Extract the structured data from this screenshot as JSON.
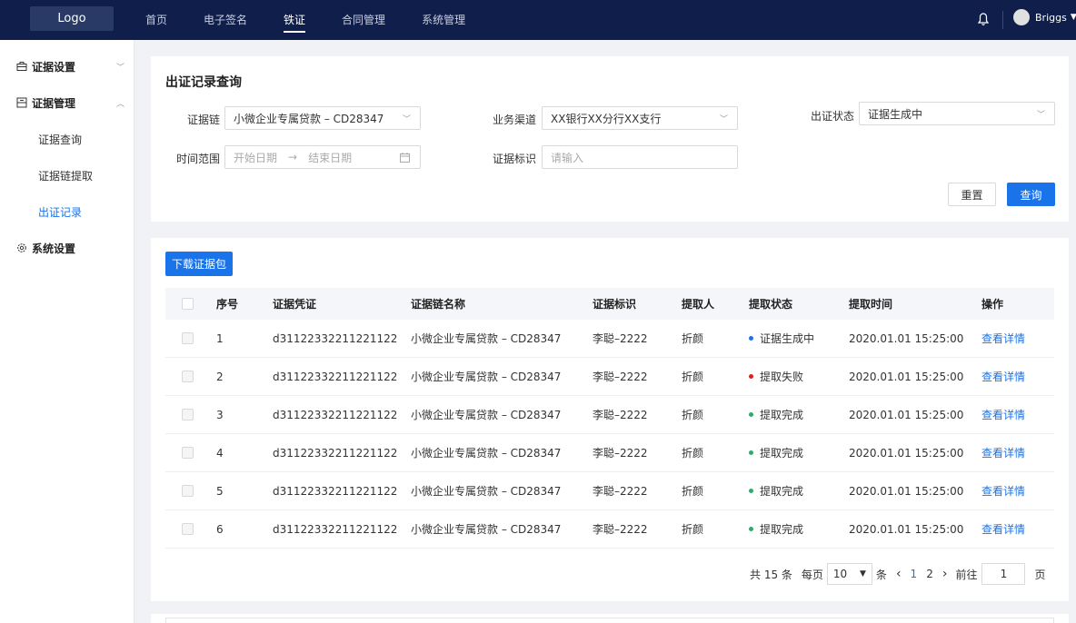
{
  "header": {
    "logo": "Logo",
    "nav": [
      "首页",
      "电子签名",
      "铁证",
      "合同管理",
      "系统管理"
    ],
    "active_nav": "铁证",
    "user_name": "Briggs"
  },
  "sidebar": {
    "groups": [
      {
        "label": "证据设置",
        "expanded": false
      },
      {
        "label": "证据管理",
        "expanded": true,
        "items": [
          "证据查询",
          "证据链提取",
          "出证记录"
        ]
      },
      {
        "label": "系统设置"
      }
    ],
    "active_item": "出证记录"
  },
  "search": {
    "title": "出证记录查询",
    "chain_label": "证据链",
    "chain_value": "小微企业专属贷款 – CD28347",
    "channel_label": "业务渠道",
    "channel_value": "XX银行XX分行XX支行",
    "status_label": "出证状态",
    "status_value": "证据生成中",
    "time_label": "时间范围",
    "start_placeholder": "开始日期",
    "arrow": "→",
    "end_placeholder": "结束日期",
    "tag_label": "证据标识",
    "tag_placeholder": "请输入",
    "reset": "重置",
    "query": "查询"
  },
  "table": {
    "download": "下载证据包",
    "headers": [
      "序号",
      "证据凭证",
      "证据链名称",
      "证据标识",
      "提取人",
      "提取状态",
      "提取时间",
      "操作"
    ],
    "rows": [
      {
        "no": "1",
        "voucher": "d31122332211221122",
        "chain": "小微企业专属贷款 – CD28347",
        "tag": "李聪–2222",
        "person": "折颜",
        "status": "证据生成中",
        "status_color": "#1a73e8",
        "time": "2020.01.01 15:25:00",
        "action": "查看详情"
      },
      {
        "no": "2",
        "voucher": "d31122332211221122",
        "chain": "小微企业专属贷款 – CD28347",
        "tag": "李聪–2222",
        "person": "折颜",
        "status": "提取失败",
        "status_color": "#e02020",
        "time": "2020.01.01 15:25:00",
        "action": "查看详情"
      },
      {
        "no": "3",
        "voucher": "d31122332211221122",
        "chain": "小微企业专属贷款 – CD28347",
        "tag": "李聪–2222",
        "person": "折颜",
        "status": "提取完成",
        "status_color": "#2eaa6a",
        "time": "2020.01.01 15:25:00",
        "action": "查看详情"
      },
      {
        "no": "4",
        "voucher": "d31122332211221122",
        "chain": "小微企业专属贷款 – CD28347",
        "tag": "李聪–2222",
        "person": "折颜",
        "status": "提取完成",
        "status_color": "#2eaa6a",
        "time": "2020.01.01 15:25:00",
        "action": "查看详情"
      },
      {
        "no": "5",
        "voucher": "d31122332211221122",
        "chain": "小微企业专属贷款 – CD28347",
        "tag": "李聪–2222",
        "person": "折颜",
        "status": "提取完成",
        "status_color": "#2eaa6a",
        "time": "2020.01.01 15:25:00",
        "action": "查看详情"
      },
      {
        "no": "6",
        "voucher": "d31122332211221122",
        "chain": "小微企业专属贷款 – CD28347",
        "tag": "李聪–2222",
        "person": "折颜",
        "status": "提取完成",
        "status_color": "#2eaa6a",
        "time": "2020.01.01 15:25:00",
        "action": "查看详情"
      }
    ]
  },
  "pagination": {
    "total": "共 15 条",
    "per_page_label": "每页",
    "per_page": "10",
    "per_page_unit": "条",
    "prev": "‹",
    "pages": [
      "1",
      "2"
    ],
    "current": "1",
    "next": "›",
    "goto_label": "前往",
    "goto_value": "1",
    "goto_unit": "页"
  },
  "colors": {
    "primary": "#1a73e8",
    "header_bg": "#0f1e4a"
  }
}
